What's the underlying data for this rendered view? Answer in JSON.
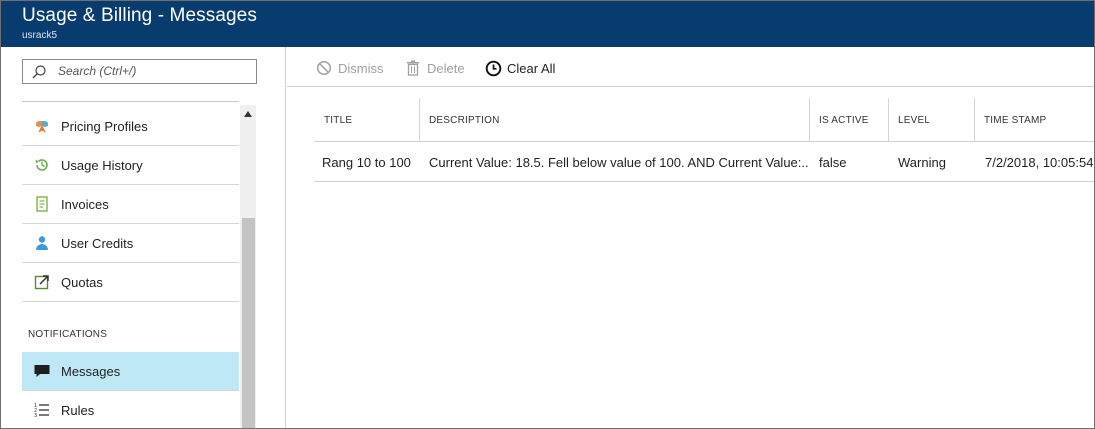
{
  "header": {
    "title": "Usage & Billing - Messages",
    "subtitle": "usrack5"
  },
  "search": {
    "placeholder": "Search (Ctrl+/)"
  },
  "menu": {
    "items": [
      {
        "label": "Pricing Profiles",
        "icon": "pricing-profiles-icon"
      },
      {
        "label": "Usage History",
        "icon": "usage-history-icon"
      },
      {
        "label": "Invoices",
        "icon": "invoice-icon"
      },
      {
        "label": "User Credits",
        "icon": "user-credits-icon"
      },
      {
        "label": "Quotas",
        "icon": "quotas-icon"
      }
    ],
    "section_label": "NOTIFICATIONS",
    "notification_items": [
      {
        "label": "Messages",
        "icon": "messages-icon",
        "selected": true
      },
      {
        "label": "Rules",
        "icon": "rules-icon",
        "selected": false
      }
    ]
  },
  "toolbar": {
    "dismiss_label": "Dismiss",
    "delete_label": "Delete",
    "clear_all_label": "Clear All"
  },
  "table": {
    "columns": [
      "TITLE",
      "DESCRIPTION",
      "IS ACTIVE",
      "LEVEL",
      "TIME STAMP"
    ],
    "rows": [
      {
        "title": "Rang 10 to 100",
        "description": "Current Value: 18.5. Fell below value of 100. AND Current Value:...",
        "is_active": "false",
        "level": "Warning",
        "time_stamp": "7/2/2018, 10:05:54"
      }
    ]
  },
  "colors": {
    "header_bg": "#083c6e",
    "selected_item_bg": "#bfe8f7"
  }
}
